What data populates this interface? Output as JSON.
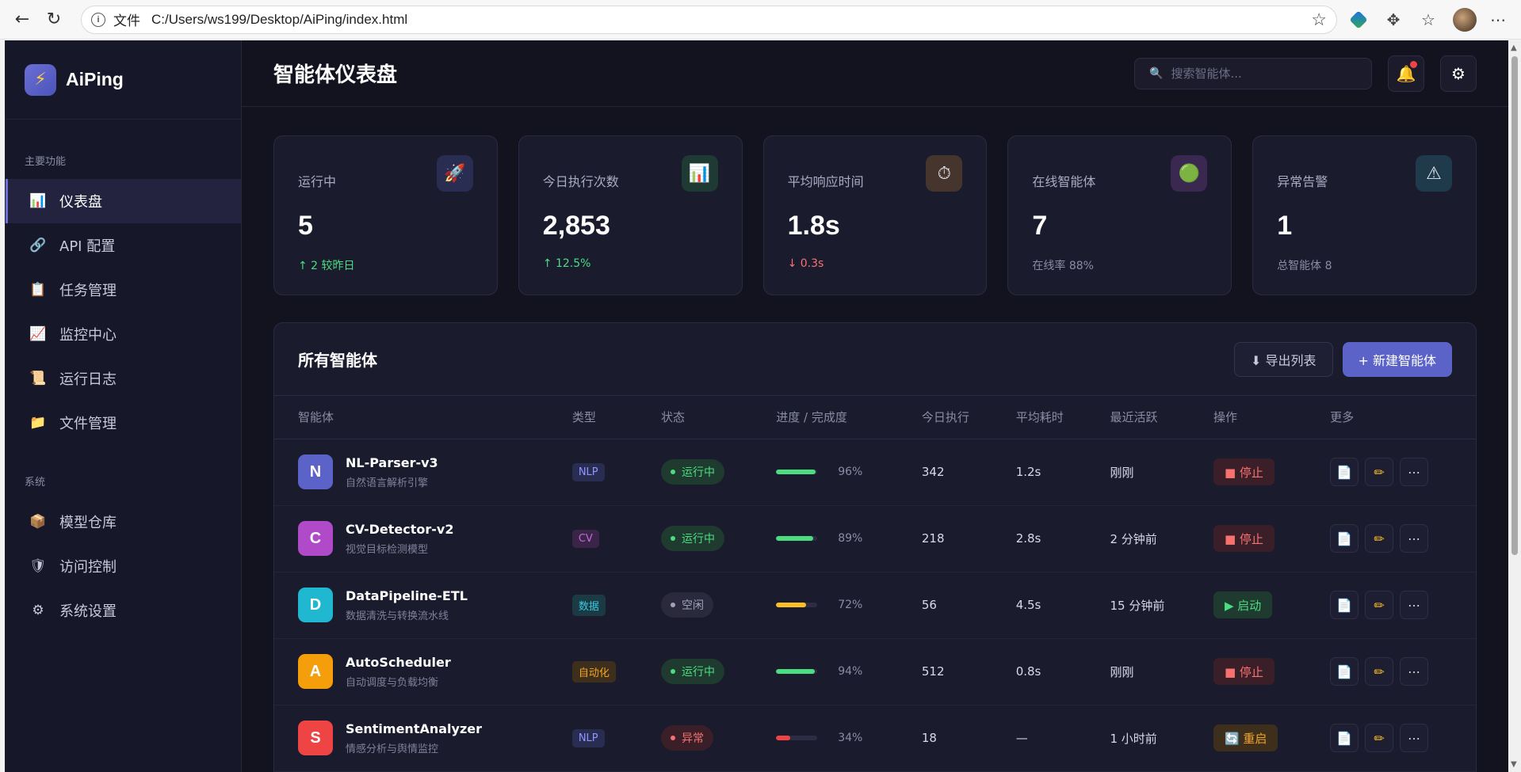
{
  "browser": {
    "scheme_label": "文件",
    "url": "C:/Users/ws199/Desktop/AiPing/index.html"
  },
  "brand": {
    "name": "AiPing",
    "logo_icon": "lightning-icon"
  },
  "sidebar": {
    "section_main": "主要功能",
    "section_system": "系统",
    "items": [
      {
        "label": "仪表盘",
        "icon": "📊"
      },
      {
        "label": "API 配置",
        "icon": "🔗"
      },
      {
        "label": "任务管理",
        "icon": "📋"
      },
      {
        "label": "监控中心",
        "icon": "📈"
      },
      {
        "label": "运行日志",
        "icon": "📜"
      },
      {
        "label": "文件管理",
        "icon": "📁"
      }
    ],
    "system_items": [
      {
        "label": "模型仓库",
        "icon": "📦"
      },
      {
        "label": "访问控制",
        "icon": "🛡"
      },
      {
        "label": "系统设置",
        "icon": "⚙"
      }
    ]
  },
  "header": {
    "title": "智能体仪表盘",
    "search_placeholder": "搜索智能体..."
  },
  "stats": [
    {
      "label": "运行中",
      "value": "5",
      "sub": "↑ 2 较昨日",
      "icon": "🚀",
      "icon_bg": "#2a2d52"
    },
    {
      "label": "今日执行次数",
      "value": "2,853",
      "sub": "↑ 12.5%",
      "icon": "📊",
      "icon_bg": "#1f3a33"
    },
    {
      "label": "平均响应时间",
      "value": "1.8s",
      "sub": "↓ 0.3s",
      "icon": "⏱",
      "icon_bg": "#45352c"
    },
    {
      "label": "在线智能体",
      "value": "7",
      "sub": "在线率 88%",
      "icon": "🟢",
      "icon_bg": "#3a2850"
    },
    {
      "label": "异常告警",
      "value": "1",
      "sub": "总智能体 8",
      "icon": "⚠",
      "icon_bg": "#1f3a4a"
    }
  ],
  "agents_panel": {
    "title": "所有智能体",
    "export_label": "⬇ 导出列表",
    "new_label": "+ 新建智能体",
    "columns": [
      "智能体",
      "类型",
      "状态",
      "进度 / 完成度",
      "今日执行",
      "平均耗时",
      "最近活跃",
      "操作",
      "更多"
    ],
    "rows": [
      {
        "initial": "N",
        "color": "#5b63c9",
        "name": "NL-Parser-v3",
        "desc": "自然语言解析引擎",
        "type": "NLP",
        "type_fg": "#8f96ff",
        "type_bg": "#2a2d52",
        "status": "运行中",
        "status_color": "#4ade80",
        "status_bg": "#1f3a2f",
        "progress": 96,
        "progress_label": "96%",
        "progress_color": "#4ade80",
        "runs": "342",
        "avg": "1.2s",
        "last": "刚刚",
        "action": "■ 停止",
        "action_fg": "#f87171",
        "action_bg": "#3a1f28"
      },
      {
        "initial": "C",
        "color": "#b04ac9",
        "name": "CV-Detector-v2",
        "desc": "视觉目标检测模型",
        "type": "CV",
        "type_fg": "#c46ad8",
        "type_bg": "#3a2448",
        "status": "运行中",
        "status_color": "#4ade80",
        "status_bg": "#1f3a2f",
        "progress": 89,
        "progress_label": "89%",
        "progress_color": "#4ade80",
        "runs": "218",
        "avg": "2.8s",
        "last": "2 分钟前",
        "action": "■ 停止",
        "action_fg": "#f87171",
        "action_bg": "#3a1f28"
      },
      {
        "initial": "D",
        "color": "#1fb8d0",
        "name": "DataPipeline-ETL",
        "desc": "数据清洗与转换流水线",
        "type": "数据",
        "type_fg": "#38c9e0",
        "type_bg": "#1c3a44",
        "status": "空闲",
        "status_color": "#a0a2b8",
        "status_bg": "#2a2a3c",
        "progress": 72,
        "progress_label": "72%",
        "progress_color": "#fbbf24",
        "runs": "56",
        "avg": "4.5s",
        "last": "15 分钟前",
        "action": "▶ 启动",
        "action_fg": "#4ade80",
        "action_bg": "#1f3a2f"
      },
      {
        "initial": "A",
        "color": "#f59e0b",
        "name": "AutoScheduler",
        "desc": "自动调度与负载均衡",
        "type": "自动化",
        "type_fg": "#f5a524",
        "type_bg": "#3d2f1c",
        "status": "运行中",
        "status_color": "#4ade80",
        "status_bg": "#1f3a2f",
        "progress": 94,
        "progress_label": "94%",
        "progress_color": "#4ade80",
        "runs": "512",
        "avg": "0.8s",
        "last": "刚刚",
        "action": "■ 停止",
        "action_fg": "#f87171",
        "action_bg": "#3a1f28"
      },
      {
        "initial": "S",
        "color": "#ef4444",
        "name": "SentimentAnalyzer",
        "desc": "情感分析与舆情监控",
        "type": "NLP",
        "type_fg": "#8f96ff",
        "type_bg": "#2a2d52",
        "status": "异常",
        "status_color": "#f87171",
        "status_bg": "#3a1f28",
        "progress": 34,
        "progress_label": "34%",
        "progress_color": "#ef4444",
        "runs": "18",
        "avg": "—",
        "last": "1 小时前",
        "action": "🔄 重启",
        "action_fg": "#f5a524",
        "action_bg": "#3d2f1c"
      }
    ]
  }
}
